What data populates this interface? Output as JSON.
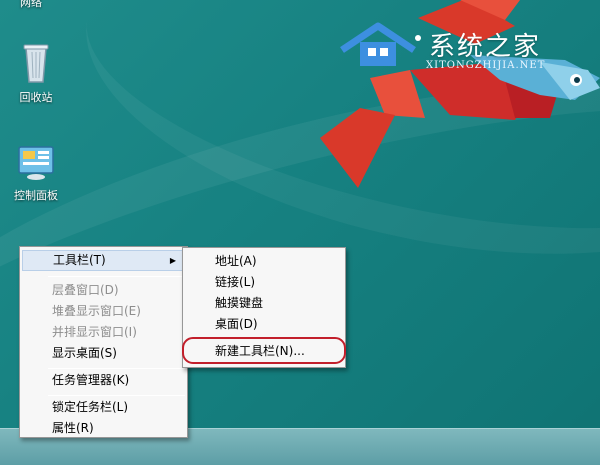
{
  "desktop": {
    "top_label": "网络",
    "icons": [
      {
        "name": "recycle-bin",
        "label": "回收站",
        "icon": "recycle-bin-icon"
      },
      {
        "name": "control-panel",
        "label": "控制面板",
        "icon": "control-panel-icon"
      }
    ]
  },
  "watermark": {
    "title": "系统之家",
    "subtitle": "XITONGZHIJIA.NET"
  },
  "context_menu": {
    "items": [
      {
        "label": "工具栏(T)",
        "has_submenu": true,
        "highlighted": true
      },
      {
        "label": "层叠窗口(D)",
        "disabled": true
      },
      {
        "label": "堆叠显示窗口(E)",
        "disabled": true
      },
      {
        "label": "并排显示窗口(I)",
        "disabled": true
      },
      {
        "label": "显示桌面(S)"
      },
      {
        "label": "任务管理器(K)"
      },
      {
        "label": "锁定任务栏(L)"
      },
      {
        "label": "属性(R)"
      }
    ]
  },
  "toolbar_submenu": {
    "items": [
      {
        "label": "地址(A)"
      },
      {
        "label": "链接(L)"
      },
      {
        "label": "触摸键盘"
      },
      {
        "label": "桌面(D)"
      },
      {
        "label": "新建工具栏(N)...",
        "circled": true
      }
    ]
  },
  "colors": {
    "desktop_teal": "#178282",
    "highlight_ring": "#c21f2b",
    "fish_red": "#d9392a"
  }
}
